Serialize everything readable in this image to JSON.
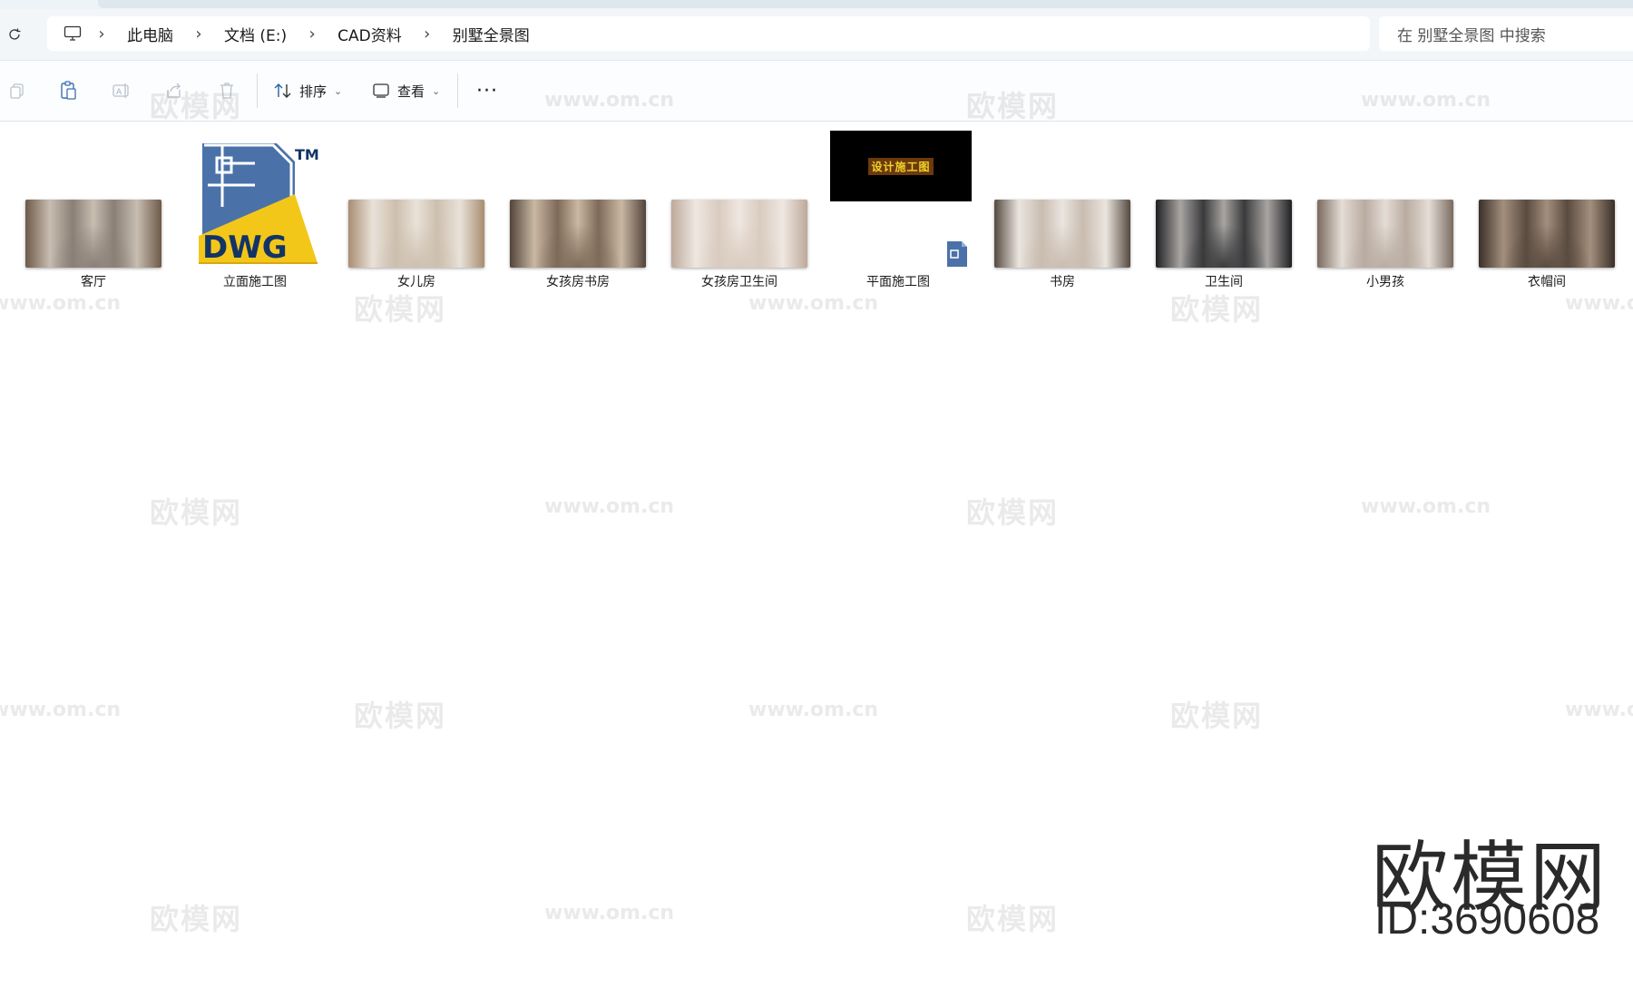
{
  "address_bar": {
    "breadcrumbs": [
      "此电脑",
      "文档 (E:)",
      "CAD资料",
      "别墅全景图"
    ],
    "search_placeholder": "在 别墅全景图 中搜索"
  },
  "toolbar": {
    "sort_label": "排序",
    "view_label": "查看",
    "more_label": "···"
  },
  "files": [
    {
      "name": "客厅",
      "kind": "panorama",
      "colors": [
        "#8a7f76",
        "#c8bdb1",
        "#6d5a48"
      ]
    },
    {
      "name": "立面施工图",
      "kind": "dwg"
    },
    {
      "name": "女儿房",
      "kind": "panorama",
      "colors": [
        "#cdbfae",
        "#e9e2d9",
        "#a88d72"
      ]
    },
    {
      "name": "女孩房书房",
      "kind": "panorama",
      "colors": [
        "#7e6a58",
        "#c9b8a4",
        "#52443a"
      ]
    },
    {
      "name": "女孩房卫生间",
      "kind": "panorama",
      "colors": [
        "#d9cbbf",
        "#efe7e1",
        "#bda99a"
      ]
    },
    {
      "name": "平面施工图",
      "kind": "plan"
    },
    {
      "name": "书房",
      "kind": "panorama",
      "colors": [
        "#c9bcb0",
        "#eae5df",
        "#55493f"
      ]
    },
    {
      "name": "卫生间",
      "kind": "panorama",
      "colors": [
        "#3a3a3c",
        "#a8a5a2",
        "#1f1f22"
      ]
    },
    {
      "name": "小男孩",
      "kind": "panorama",
      "colors": [
        "#b9aba0",
        "#e4ddd6",
        "#7a6a5e"
      ]
    },
    {
      "name": "衣帽间",
      "kind": "panorama",
      "colors": [
        "#5a4b40",
        "#a38f7d",
        "#3a2f28"
      ]
    }
  ],
  "dwg_icon": {
    "text": "DWG",
    "tm": "TM"
  },
  "plan_thumb_text": "设计施工图",
  "watermark": {
    "cn": "欧模网",
    "url": "www.om.cn"
  },
  "brand": {
    "logo": "欧模网",
    "id": "ID:3690608"
  }
}
